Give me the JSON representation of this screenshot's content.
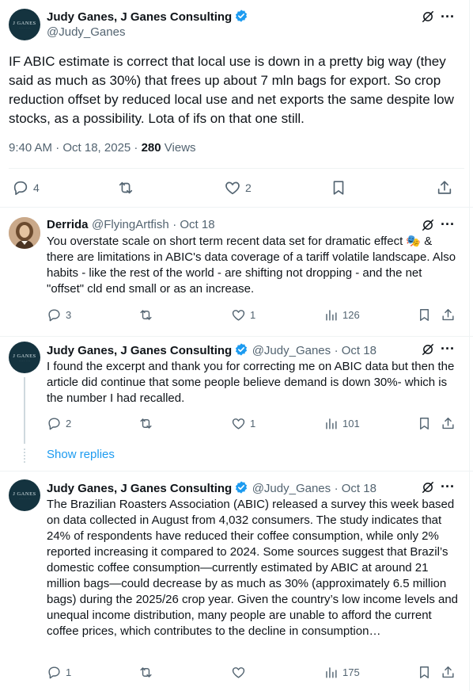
{
  "main_post": {
    "author": "Judy Ganes, J Ganes Consulting",
    "handle": "@Judy_Ganes",
    "avatar_text": "J GANES",
    "body": "IF ABIC estimate is correct that local use is down in a pretty big way (they said as much as 30%) that frees up about 7 mln bags for export.   So crop reduction offset by reduced local use and net exports the same despite low stocks, as a possibility.  Lota of ifs on that one still.",
    "timestamp": "9:40 AM · Oct 18, 2025 · ",
    "views_count": "280",
    "views_label": " Views",
    "replies": "4",
    "reposts": "",
    "likes": "2"
  },
  "replies": [
    {
      "author": "Derrida",
      "handle": "@FlyingArtfish",
      "date": "· Oct 18",
      "body": "You overstate scale on short term recent data set for dramatic effect 🎭 & there are limitations in ABIC's data coverage of a tariff volatile landscape. Also habits - like the rest of the world - are shifting not dropping - and the net \"offset\" cld end small or as an increase.",
      "replies": "3",
      "likes": "1",
      "views": "126"
    },
    {
      "author": "Judy Ganes, J Ganes Consulting",
      "handle": "@Judy_Ganes",
      "date": "· Oct 18",
      "avatar_text": "J GANES",
      "body": "I found the excerpt and thank you for correcting me on ABIC data but then the article did continue that some people believe demand is down 30%- which is the number I had recalled.",
      "replies": "2",
      "likes": "1",
      "views": "101"
    },
    {
      "author": "Judy Ganes, J Ganes Consulting",
      "handle": "@Judy_Ganes",
      "date": "· Oct 18",
      "avatar_text": "J GANES",
      "body": "The Brazilian Roasters Association (ABIC) released a survey this week based on data collected in August from 4,032 consumers. The study indicates that 24% of respondents have reduced their coffee consumption, while only 2% reported increasing it compared to 2024. Some sources suggest that Brazil’s domestic coffee consumption—currently estimated by ABIC at around 21 million bags—could decrease by as much as 30% (approximately 6.5 million bags) during the 2025/26 crop year. Given the country’s low income levels and unequal income distribution, many people are unable to afford the current coffee prices, which contributes to the decline in consumption…",
      "replies": "1",
      "likes": "",
      "views": "175"
    }
  ],
  "show_replies_label": "Show replies",
  "colors": {
    "text": "#0f1419",
    "muted": "#536471",
    "link": "#1d9bf0",
    "verified": "#1d9bf0",
    "divider": "#eff3f4",
    "avatar_bg": "#14333f"
  },
  "icons": [
    "grok-icon",
    "more-icon",
    "reply-icon",
    "repost-icon",
    "like-icon",
    "views-icon",
    "bookmark-icon",
    "share-icon",
    "verified-icon"
  ]
}
